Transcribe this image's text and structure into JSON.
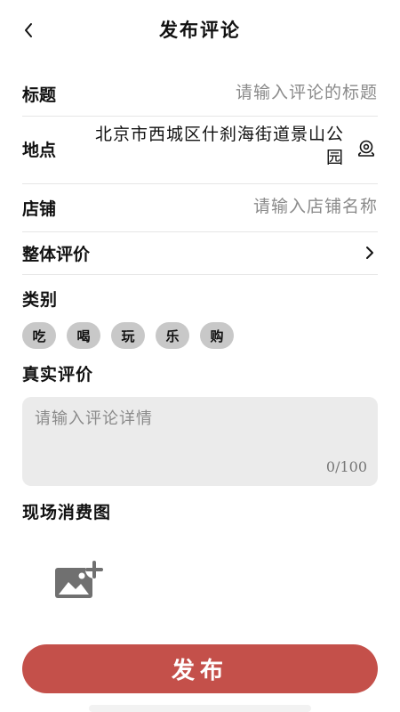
{
  "header": {
    "title": "发布评论"
  },
  "form": {
    "title_label": "标题",
    "title_placeholder": "请输入评论的标题",
    "location_label": "地点",
    "location_value": "北京市西城区什刹海街道景山公园",
    "shop_label": "店铺",
    "shop_placeholder": "请输入店铺名称",
    "overall_label": "整体评价",
    "category_label": "类别",
    "categories": [
      "吃",
      "喝",
      "玩",
      "乐",
      "购"
    ],
    "review_label": "真实评价",
    "review_placeholder": "请输入评论详情",
    "review_counter": "0/100",
    "photo_label": "现场消费图"
  },
  "actions": {
    "submit_label": "发布"
  },
  "colors": {
    "accent": "#c4504a",
    "chip_bg": "#c8c8c8",
    "textarea_bg": "#ebebeb"
  }
}
